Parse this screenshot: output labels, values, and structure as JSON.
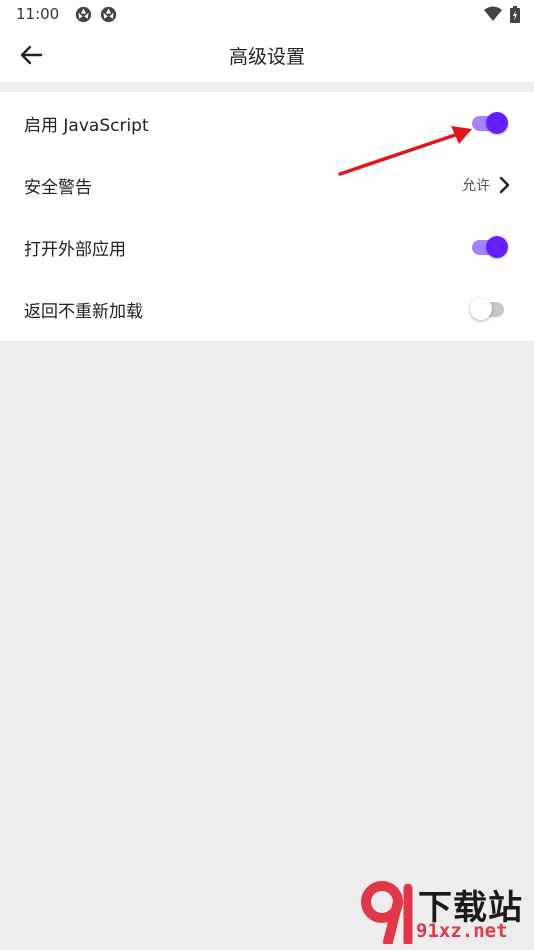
{
  "status_bar": {
    "time": "11:00"
  },
  "header": {
    "title": "高级设置"
  },
  "settings": [
    {
      "label": "启用 JavaScript",
      "toggle": true
    },
    {
      "label": "安全警告",
      "value": "允许"
    },
    {
      "label": "打开外部应用",
      "toggle": true
    },
    {
      "label": "返回不重新加载",
      "toggle": false
    }
  ],
  "colors": {
    "accent": "#651fff",
    "accent_track": "#a682ff",
    "annotation": "#e3161b"
  },
  "watermark": {
    "top": "下载站",
    "bottom": "91xz.net"
  }
}
